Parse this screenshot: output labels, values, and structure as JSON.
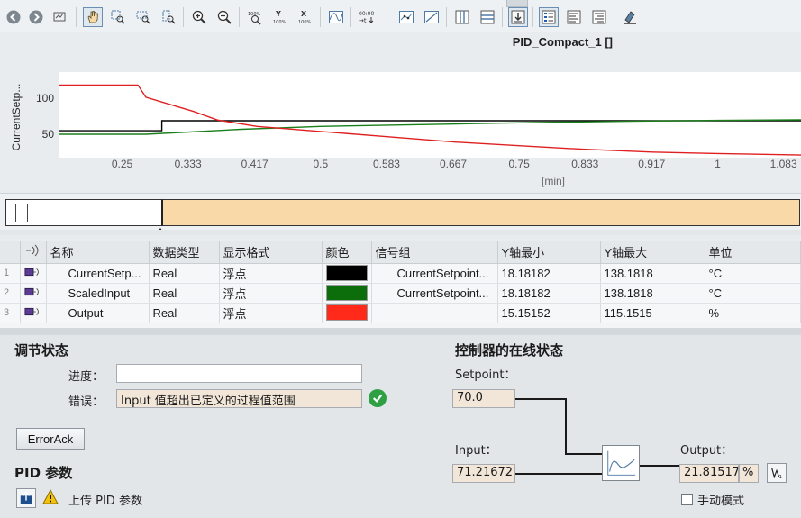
{
  "toolbar": {
    "icons": [
      "back-icon",
      "forward-icon",
      "print-icon",
      "pan-icon",
      "zoom-rect-icon",
      "zoom-x-icon",
      "zoom-y-icon",
      "zoom-in-icon",
      "zoom-out-icon",
      "zoom-100-icon",
      "scale-y-100-icon",
      "scale-x-100-icon",
      "curve-icon",
      "measure-icon",
      "point-icon",
      "line-icon",
      "split-v-icon",
      "split-h-icon",
      "export-icon",
      "legend-list-icon",
      "align-left-icon",
      "align-right-icon",
      "highlight-icon"
    ]
  },
  "chart_title": "PID_Compact_1 []",
  "chart_data": {
    "type": "line",
    "ylabel": "CurrentSetp...",
    "xlabel": "[min]",
    "x_ticks": [
      "0.25",
      "0.333",
      "0.417",
      "0.5",
      "0.583",
      "0.667",
      "0.75",
      "0.833",
      "0.917",
      "1",
      "1.083"
    ],
    "y_ticks": [
      "100",
      "50"
    ],
    "xlim": [
      0.17,
      1.105
    ],
    "ylim": [
      18.18182,
      138.1818
    ],
    "series": [
      {
        "name": "CurrentSetpoint",
        "color": "#000000",
        "x": [
          0.17,
          0.3,
          0.3,
          1.105
        ],
        "y": [
          56,
          56,
          70,
          70
        ]
      },
      {
        "name": "ScaledInput",
        "color": "#1a7f1a",
        "x": [
          0.17,
          0.28,
          0.4,
          0.5,
          0.6,
          0.7,
          0.8,
          0.9,
          1.0,
          1.105
        ],
        "y": [
          51,
          51,
          58,
          62,
          64,
          66,
          68,
          69.5,
          70.5,
          71.2
        ]
      },
      {
        "name": "Output",
        "color": "#e02020",
        "x": [
          0.17,
          0.27,
          0.28,
          0.31,
          0.34,
          0.37,
          0.42,
          0.5,
          0.58,
          0.67,
          0.75,
          0.83,
          0.917,
          1.0,
          1.05,
          1.105
        ],
        "y": [
          120,
          120,
          103,
          93,
          83,
          71,
          62,
          55,
          48,
          40,
          35,
          30,
          26,
          24,
          23,
          21.8
        ]
      }
    ]
  },
  "table": {
    "headers": [
      "名称",
      "数据类型",
      "显示格式",
      "颜色",
      "信号组",
      "Y轴最小",
      "Y轴最大",
      "单位"
    ],
    "rows": [
      {
        "num": "1",
        "name": "CurrentSetp...",
        "type": "Real",
        "format": "浮点",
        "color": "#000000",
        "group": "CurrentSetpoint...",
        "ymin": "18.18182",
        "ymax": "138.1818",
        "unit": "°C"
      },
      {
        "num": "2",
        "name": "ScaledInput",
        "type": "Real",
        "format": "浮点",
        "color": "#0b6e0b",
        "group": "CurrentSetpoint...",
        "ymin": "18.18182",
        "ymax": "138.1818",
        "unit": "°C"
      },
      {
        "num": "3",
        "name": "Output",
        "type": "Real",
        "format": "浮点",
        "color": "#ff2a1a",
        "group": "",
        "ymin": "15.15152",
        "ymax": "115.1515",
        "unit": "%"
      }
    ]
  },
  "tuning": {
    "title": "调节状态",
    "progress_label": "进度：",
    "progress_value": "",
    "error_label": "错误：",
    "error_value": "Input 值超出已定义的过程值范围",
    "erroradk_button": "ErrorAck"
  },
  "pid_params": {
    "title": "PID 参数",
    "upload_label": "上传 PID 参数"
  },
  "online": {
    "title": "控制器的在线状态",
    "setpoint_label": "Setpoint：",
    "setpoint_value": "70.0",
    "input_label": "Input：",
    "input_value": "71.21672",
    "output_label": "Output：",
    "output_value": "21.81517",
    "output_unit": "%",
    "manual_label": "手动模式"
  }
}
